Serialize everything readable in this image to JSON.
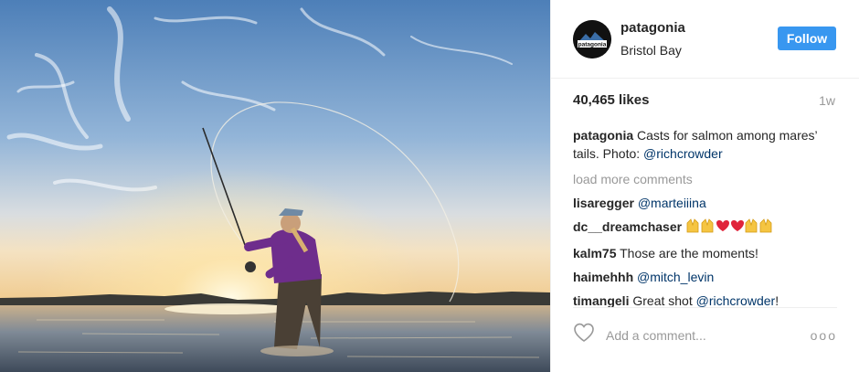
{
  "post": {
    "username": "patagonia",
    "location": "Bristol Bay",
    "follow_label": "Follow",
    "avatar_text": "patagonia",
    "likes": "40,465 likes",
    "time_ago": "1w",
    "caption": {
      "user": "patagonia",
      "text": "Casts for salmon among mares’ tails. Photo:",
      "mention": "@richcrowder"
    },
    "load_more": "load more comments",
    "comments": [
      {
        "user": "lisaregger",
        "mention": "@marteiiina",
        "text": ""
      },
      {
        "user": "dc__dreamchaser",
        "mention": "",
        "text": ""
      },
      {
        "user": "kalm75",
        "mention": "",
        "text": "Those are the moments!"
      },
      {
        "user": "haimehhh",
        "mention": "@mitch_levin",
        "text": ""
      },
      {
        "user": "timangeli",
        "text": "Great shot",
        "mention": "@richcrowder",
        "suffix": "!"
      }
    ],
    "add_comment_placeholder": "Add a comment...",
    "more_icon": "ooo",
    "colors": {
      "accent": "#3897f0",
      "mention": "#003569",
      "muted": "#999999"
    }
  }
}
